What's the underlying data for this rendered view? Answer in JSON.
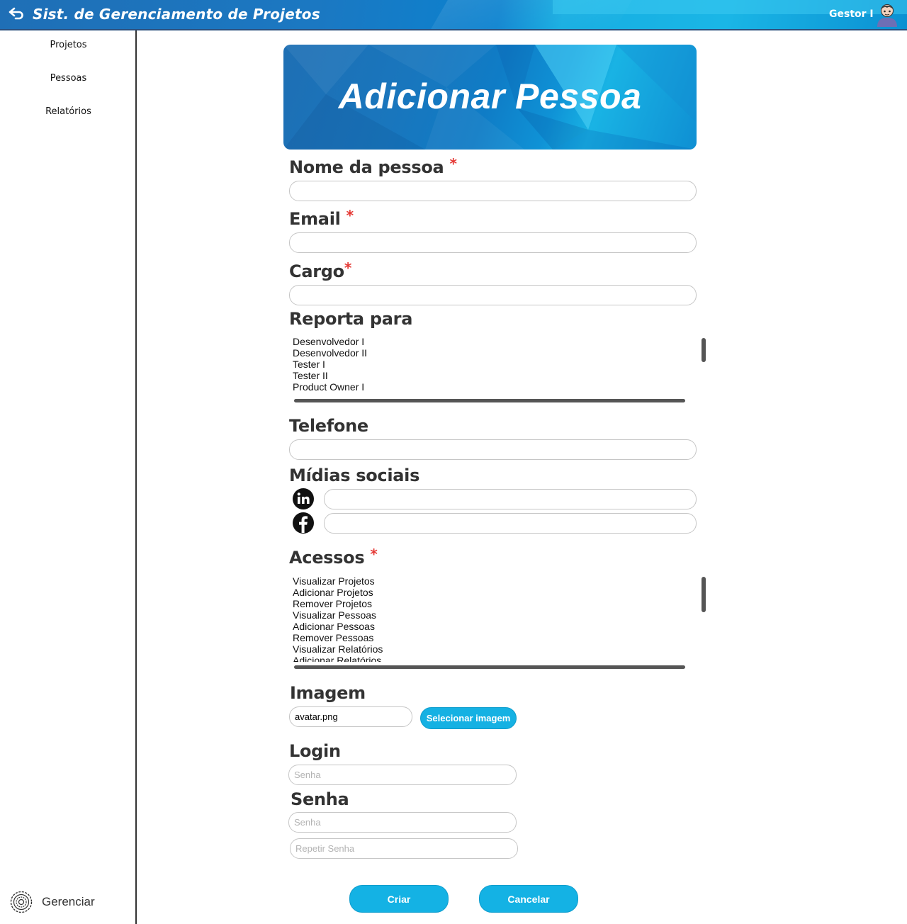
{
  "header": {
    "title": "Sist. de Gerenciamento de Projetos",
    "user": "Gestor I",
    "back_icon": "back-arrow-icon",
    "avatar_icon": "user-avatar-icon"
  },
  "sidebar": {
    "items": [
      {
        "label": "Projetos"
      },
      {
        "label": "Pessoas"
      },
      {
        "label": "Relatórios"
      }
    ],
    "manage": {
      "label": "Gerenciar",
      "icon": "gear-icon"
    }
  },
  "banner": {
    "title": "Adicionar Pessoa"
  },
  "form": {
    "name": {
      "label": "Nome da pessoa",
      "required": "*",
      "value": ""
    },
    "email": {
      "label": "Email",
      "required": "*",
      "value": ""
    },
    "cargo": {
      "label": "Cargo",
      "required": "*",
      "value": ""
    },
    "reporta": {
      "label": "Reporta para",
      "options": [
        "Desenvolvedor I",
        "Desenvolvedor II",
        "Tester I",
        "Tester II",
        "Product Owner I"
      ]
    },
    "telefone": {
      "label": "Telefone",
      "value": ""
    },
    "midias": {
      "label": "Mídias sociais",
      "linkedin_icon": "linkedin-icon",
      "facebook_icon": "facebook-icon"
    },
    "acessos": {
      "label": "Acessos",
      "required": "*",
      "options": [
        "Visualizar Projetos",
        "Adicionar Projetos",
        "Remover Projetos",
        "Visualizar Pessoas",
        "Adicionar Pessoas",
        "Remover Pessoas",
        "Visualizar Relatórios",
        "Adicionar Relatórios"
      ]
    },
    "imagem": {
      "label": "Imagem",
      "value": "avatar.png",
      "button": "Selecionar imagem"
    },
    "login": {
      "label": "Login",
      "placeholder": "Senha"
    },
    "senha": {
      "label": "Senha",
      "placeholder": "Senha",
      "repeat_placeholder": "Repetir Senha"
    }
  },
  "actions": {
    "create": "Criar",
    "cancel": "Cancelar"
  },
  "colors": {
    "accent": "#14b2e4",
    "header": "#1b78c2",
    "required": "#e53935"
  }
}
